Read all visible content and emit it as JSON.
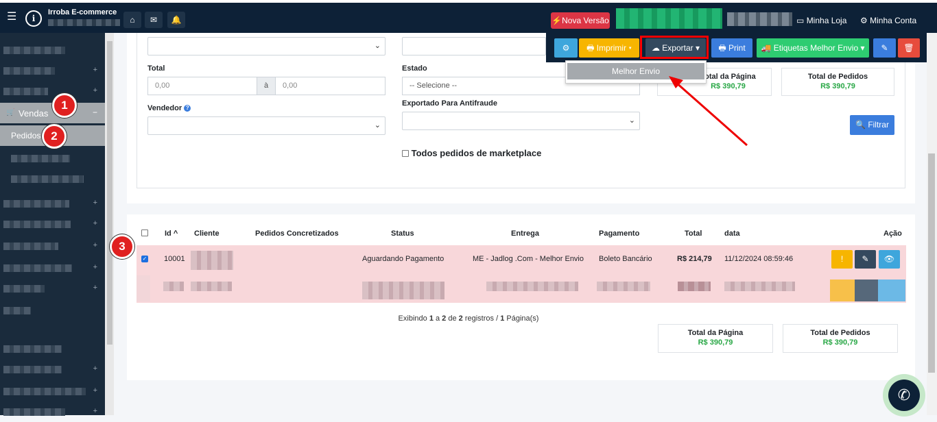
{
  "navbar": {
    "brand": "Irroba E-commerce",
    "nova_versao": "⚡Nova Versão",
    "minha_loja": "Minha Loja",
    "minha_conta": "Minha Conta"
  },
  "sidebar": {
    "vendas": "Vendas",
    "pedidos": "Pedidos"
  },
  "badges": [
    "1",
    "2",
    "3"
  ],
  "filters": {
    "total_label": "Total",
    "total_from_placeholder": "0,00",
    "between": "à",
    "total_to_placeholder": "0,00",
    "estado_label": "Estado",
    "estado_value": "-- Selecione --",
    "vendedor_label": "Vendedor",
    "antifraude_label": "Exportado Para Antifraude",
    "marketplace_label": "Todos pedidos de marketplace",
    "filtrar": "Filtrar"
  },
  "totals_top": {
    "pagina_title": "Total da Página",
    "pagina_value": "R$ 390,79",
    "pedidos_title": "Total de Pedidos",
    "pedidos_value": "R$ 390,79"
  },
  "toolbar": {
    "imprimir": "Imprimir",
    "exportar": "Exportar",
    "print": "Print",
    "etiquetas": "Etiquetas Melhor Envio"
  },
  "dropdown": {
    "item": "Melhor Envio"
  },
  "table": {
    "headers": [
      "Id",
      "Cliente",
      "Pedidos Concretizados",
      "Status",
      "Entrega",
      "Pagamento",
      "Total",
      "data",
      "Ação"
    ],
    "rows": [
      {
        "id": "10001",
        "status": "Aguardando Pagamento",
        "entrega": "ME - Jadlog .Com - Melhor Envio",
        "pagamento": "Boleto Bancário",
        "total": "R$ 214,79",
        "data": "11/12/2024 08:59:46"
      }
    ]
  },
  "pagination": {
    "prefix": "Exibindo ",
    "from": "1",
    "a": " a ",
    "to": "2",
    "de": " de ",
    "total": "2",
    "registros": " registros / ",
    "pages": "1",
    "suffix": " Página(s)"
  },
  "totals_bottom": {
    "pagina_title": "Total da Página",
    "pagina_value": "R$ 390,79",
    "pedidos_title": "Total de Pedidos",
    "pedidos_value": "R$ 390,79"
  },
  "colors": {
    "navbar": "#0d2137",
    "danger": "#dc3545",
    "success": "#28a745",
    "primary": "#3b7ddd",
    "warning": "#f7b500",
    "info": "#3ea6dc",
    "row_highlight": "#f8d7da"
  }
}
